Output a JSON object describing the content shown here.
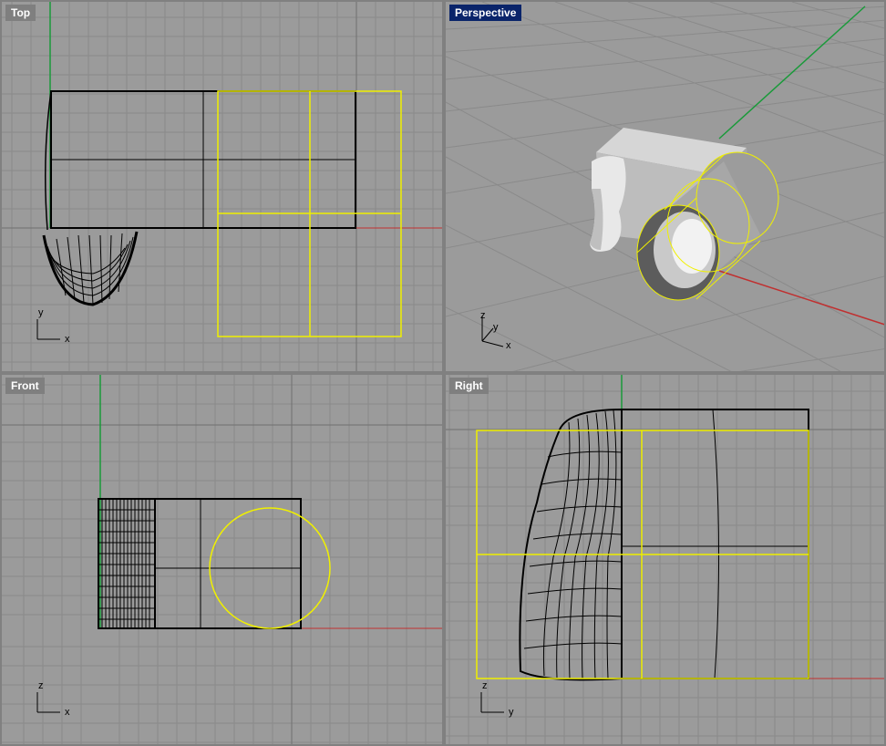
{
  "viewports": {
    "top": {
      "title": "Top",
      "axes": [
        "y",
        "x"
      ]
    },
    "perspective": {
      "title": "Perspective",
      "axes": [
        "z",
        "y",
        "x"
      ]
    },
    "front": {
      "title": "Front",
      "axes": [
        "z",
        "x"
      ]
    },
    "right": {
      "title": "Right",
      "axes": [
        "z",
        "y"
      ]
    }
  },
  "colors": {
    "viewport_bg": "#9b9b9b",
    "grid": "#8a8a8a",
    "grid_major": "#7a7a7a",
    "x_axis": "#c03030",
    "y_axis": "#1a9a3a",
    "wire": "#000000",
    "selected": "#f0f000",
    "active_title_bg": "#0a246a"
  }
}
